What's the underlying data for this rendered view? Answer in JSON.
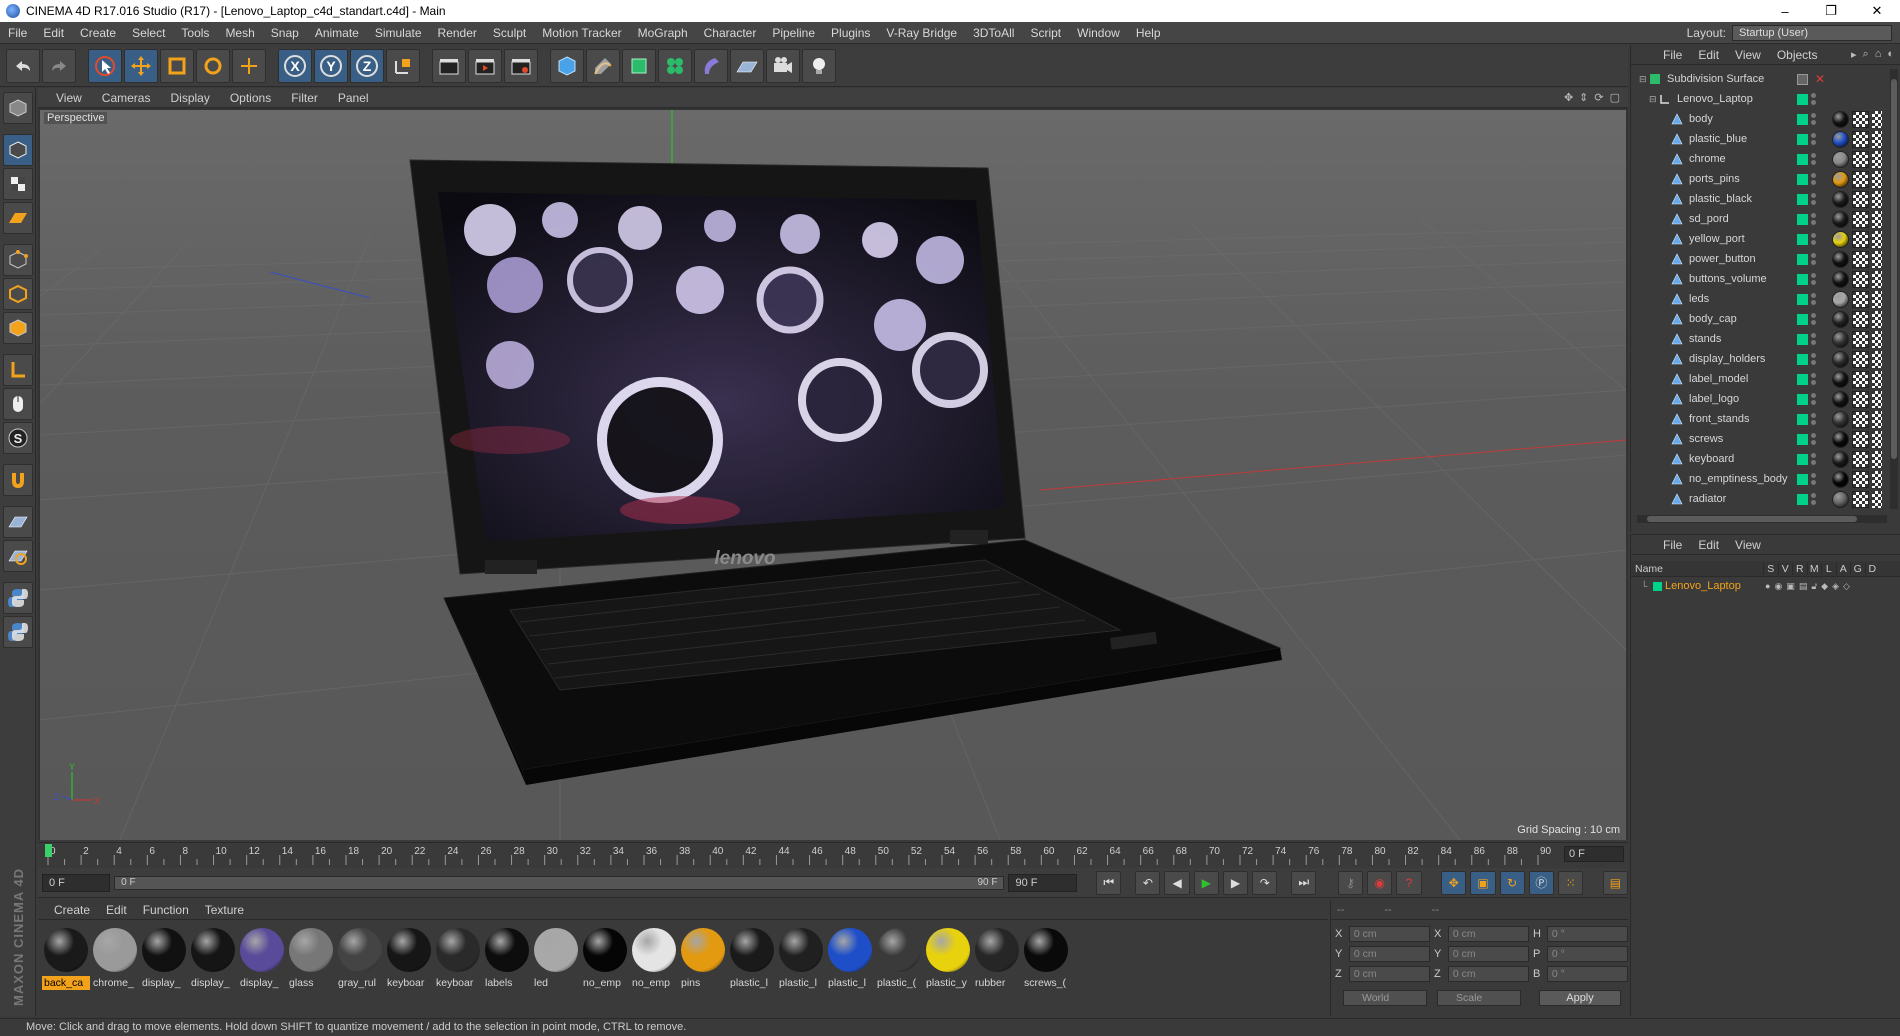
{
  "window": {
    "title": "CINEMA 4D R17.016 Studio (R17) - [Lenovo_Laptop_c4d_standart.c4d] - Main",
    "minimize": "–",
    "restore": "❐",
    "close": "✕"
  },
  "menubar": {
    "items": [
      "File",
      "Edit",
      "Create",
      "Select",
      "Tools",
      "Mesh",
      "Snap",
      "Animate",
      "Simulate",
      "Render",
      "Sculpt",
      "Motion Tracker",
      "MoGraph",
      "Character",
      "Pipeline",
      "Plugins",
      "V-Ray Bridge",
      "3DToAll",
      "Script",
      "Window",
      "Help"
    ],
    "layout_label": "Layout:",
    "layout_value": "Startup (User)"
  },
  "toolbar": {
    "x_label": "X",
    "y_label": "Y",
    "z_label": "Z"
  },
  "lefttoolbar": {
    "s_label": "S"
  },
  "brand": "MAXON CINEMA 4D",
  "viewport": {
    "menus": [
      "View",
      "Cameras",
      "Display",
      "Options",
      "Filter",
      "Panel"
    ],
    "label": "Perspective",
    "grid_spacing": "Grid Spacing : 10 cm",
    "screen_brand": "lenovo",
    "axis_y": "Y",
    "axis_x": "X",
    "axis_z": "Z"
  },
  "timeline": {
    "ticks": [
      0,
      2,
      4,
      6,
      8,
      10,
      12,
      14,
      16,
      18,
      20,
      22,
      24,
      26,
      28,
      30,
      32,
      34,
      36,
      38,
      40,
      42,
      44,
      46,
      48,
      50,
      52,
      54,
      56,
      58,
      60,
      62,
      64,
      66,
      68,
      70,
      72,
      74,
      76,
      78,
      80,
      82,
      84,
      86,
      88,
      90
    ],
    "min": 0,
    "max": 90,
    "current": 0,
    "frame_right": "0 F"
  },
  "playback": {
    "start_field": "0 F",
    "slider_left": "0 F",
    "slider_right": "90 F",
    "end_field": "90 F"
  },
  "materials": {
    "menus": [
      "Create",
      "Edit",
      "Function",
      "Texture"
    ],
    "items": [
      {
        "name": "back_ca",
        "color": "#1a1a1a",
        "selected": true
      },
      {
        "name": "chrome_",
        "color": "#9a9a9a",
        "selected": false
      },
      {
        "name": "display_",
        "color": "#111111",
        "selected": false
      },
      {
        "name": "display_",
        "color": "#151515",
        "selected": false
      },
      {
        "name": "display_",
        "color": "#5a4a9a",
        "selected": false
      },
      {
        "name": "glass",
        "color": "#777777",
        "selected": false
      },
      {
        "name": "gray_rul",
        "color": "#444444",
        "selected": false
      },
      {
        "name": "keyboar",
        "color": "#161616",
        "selected": false
      },
      {
        "name": "keyboar",
        "color": "#2a2a2a",
        "selected": false
      },
      {
        "name": "labels",
        "color": "#0d0d0d",
        "selected": false
      },
      {
        "name": "led",
        "color": "#a8a8a8",
        "selected": false
      },
      {
        "name": "no_emp",
        "color": "#050505",
        "selected": false
      },
      {
        "name": "no_emp",
        "color": "#e4e4e4",
        "selected": false
      },
      {
        "name": "pins",
        "color": "#e39a10",
        "selected": false
      },
      {
        "name": "plastic_l",
        "color": "#1a1a1a",
        "selected": false
      },
      {
        "name": "plastic_l",
        "color": "#202020",
        "selected": false
      },
      {
        "name": "plastic_l",
        "color": "#1f4fc8",
        "selected": false
      },
      {
        "name": "plastic_(",
        "color": "#3a3a3a",
        "selected": false
      },
      {
        "name": "plastic_y",
        "color": "#e8d20e",
        "selected": false
      },
      {
        "name": "rubber",
        "color": "#262626",
        "selected": false
      },
      {
        "name": "screws_(",
        "color": "#0a0a0a",
        "selected": false
      }
    ]
  },
  "coords": {
    "headers": [
      "--",
      "--",
      "--"
    ],
    "rows": [
      {
        "a1": "X",
        "v1": "0 cm",
        "a2": "X",
        "v2": "0 cm",
        "a3": "H",
        "v3": "0 °"
      },
      {
        "a1": "Y",
        "v1": "0 cm",
        "a2": "Y",
        "v2": "0 cm",
        "a3": "P",
        "v3": "0 °"
      },
      {
        "a1": "Z",
        "v1": "0 cm",
        "a2": "Z",
        "v2": "0 cm",
        "a3": "B",
        "v3": "0 °"
      }
    ],
    "world": "World",
    "scale": "Scale",
    "apply": "Apply"
  },
  "status": "Move: Click and drag to move elements. Hold down SHIFT to quantize movement / add to the selection in point mode, CTRL to remove.",
  "objects": {
    "menus": [
      "File",
      "Edit",
      "View",
      "Objects"
    ],
    "root": "Subdivision Surface",
    "group": "Lenovo_Laptop",
    "items": [
      {
        "name": "body",
        "mat": "#111111"
      },
      {
        "name": "plastic_blue",
        "mat": "#1f4fc8"
      },
      {
        "name": "chrome",
        "mat": "#8a8a8a"
      },
      {
        "name": "ports_pins",
        "mat": "#e39a10"
      },
      {
        "name": "plastic_black",
        "mat": "#1a1a1a"
      },
      {
        "name": "sd_pord",
        "mat": "#1a1a1a"
      },
      {
        "name": "yellow_port",
        "mat": "#e8d20e"
      },
      {
        "name": "power_button",
        "mat": "#111111"
      },
      {
        "name": "buttons_volume",
        "mat": "#111111"
      },
      {
        "name": "leds",
        "mat": "#a8a8a8"
      },
      {
        "name": "body_cap",
        "mat": "#222222"
      },
      {
        "name": "stands",
        "mat": "#333333"
      },
      {
        "name": "display_holders",
        "mat": "#2a2a2a"
      },
      {
        "name": "label_model",
        "mat": "#111111"
      },
      {
        "name": "label_logo",
        "mat": "#111111"
      },
      {
        "name": "front_stands",
        "mat": "#333333"
      },
      {
        "name": "screws",
        "mat": "#0a0a0a"
      },
      {
        "name": "keyboard",
        "mat": "#1a1a1a"
      },
      {
        "name": "no_emptiness_body",
        "mat": "#050505"
      },
      {
        "name": "radiator",
        "mat": "#666666"
      }
    ]
  },
  "layers": {
    "menus": [
      "File",
      "Edit",
      "View"
    ],
    "header_name": "Name",
    "header_cols": [
      "S",
      "V",
      "R",
      "M",
      "L",
      "A",
      "G",
      "D"
    ],
    "row_name": "Lenovo_Laptop"
  },
  "colors": {
    "accent_blue": "#3a5f86",
    "selection_orange": "#f2a21b",
    "layer_green": "#00d28a"
  }
}
